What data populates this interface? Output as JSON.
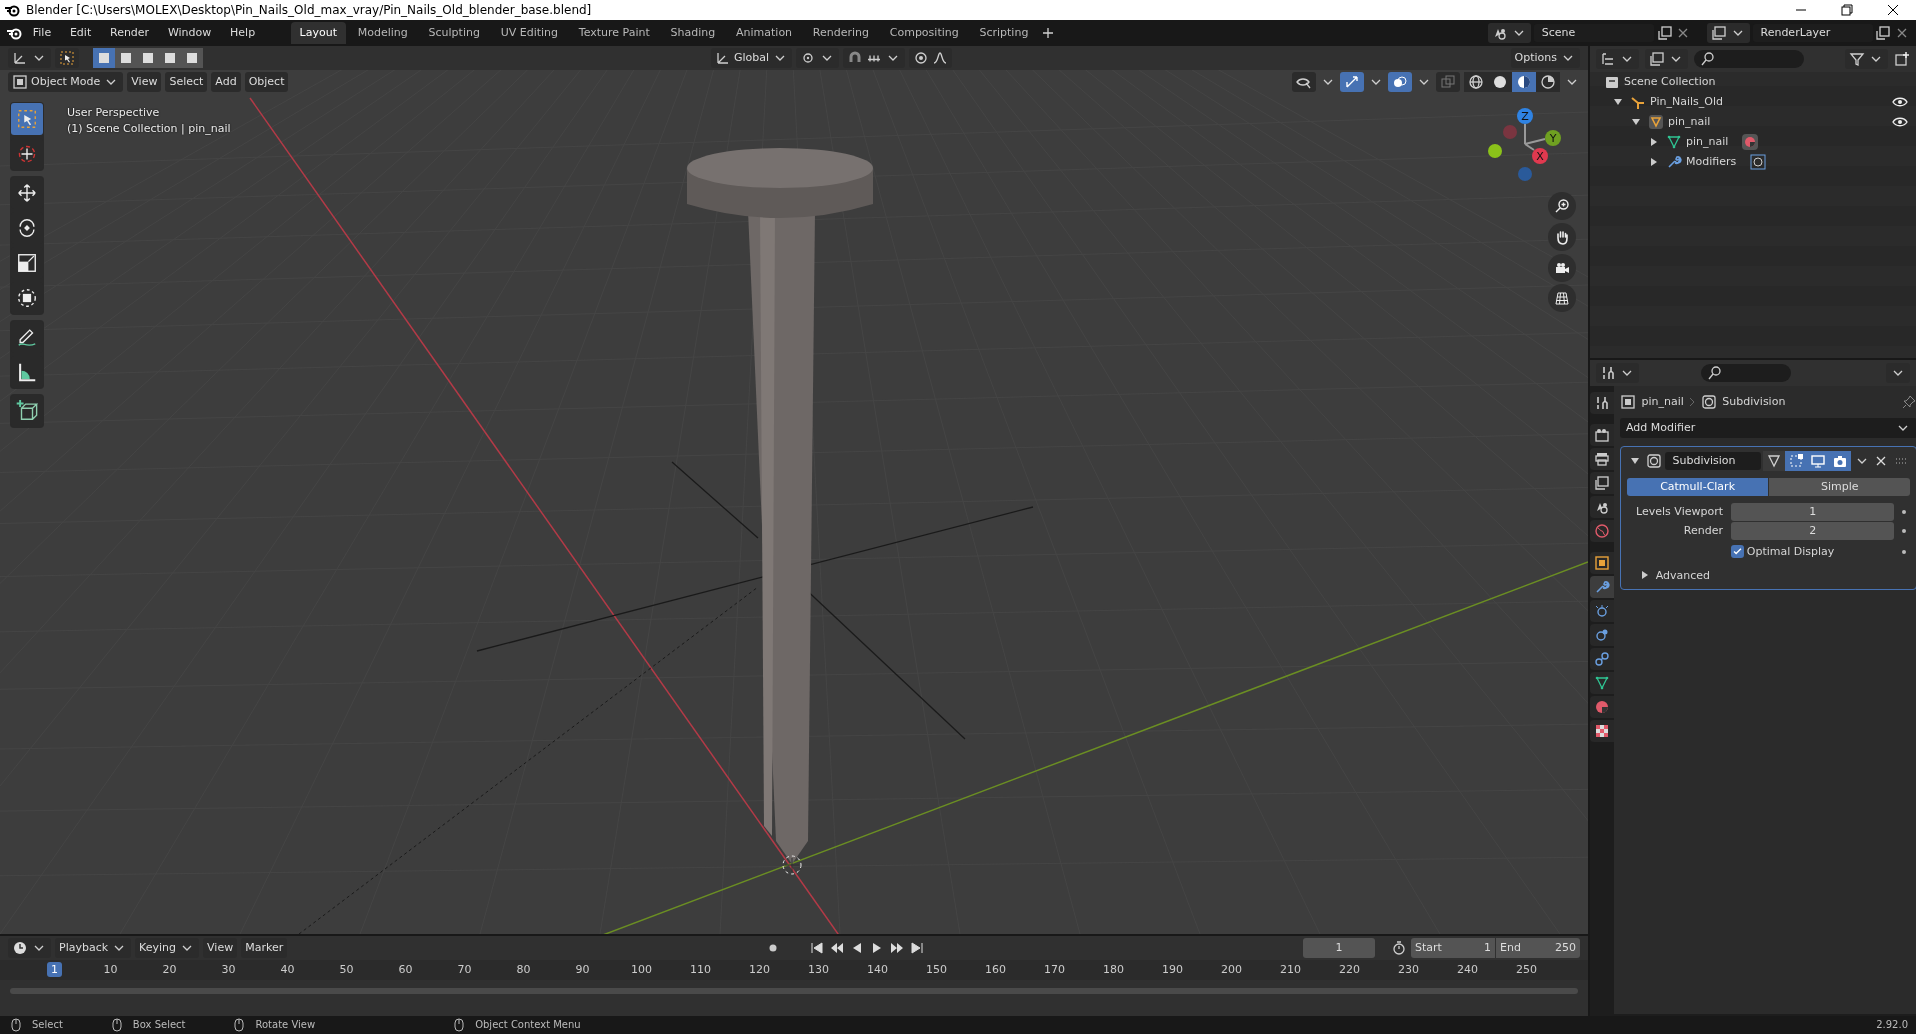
{
  "window": {
    "title": "Blender [C:\\Users\\MOLEX\\Desktop\\Pin_Nails_Old_max_vray/Pin_Nails_Old_blender_base.blend]"
  },
  "menu": [
    "File",
    "Edit",
    "Render",
    "Window",
    "Help"
  ],
  "workspaces": [
    {
      "label": "Layout",
      "selected": true
    },
    {
      "label": "Modeling",
      "selected": false
    },
    {
      "label": "Sculpting",
      "selected": false
    },
    {
      "label": "UV Editing",
      "selected": false
    },
    {
      "label": "Texture Paint",
      "selected": false
    },
    {
      "label": "Shading",
      "selected": false
    },
    {
      "label": "Animation",
      "selected": false
    },
    {
      "label": "Rendering",
      "selected": false
    },
    {
      "label": "Compositing",
      "selected": false
    },
    {
      "label": "Scripting",
      "selected": false
    }
  ],
  "scene": {
    "scene": "Scene",
    "render_layer": "RenderLayer"
  },
  "tool_header": {
    "select_modes": [
      {
        "selected": true
      },
      {
        "selected": false
      },
      {
        "selected": false
      },
      {
        "selected": false
      },
      {
        "selected": false
      }
    ],
    "orientation": "Global",
    "snap_on": false,
    "proportional_on": false,
    "options": "Options"
  },
  "viewport": {
    "mode": "Object Mode",
    "menus": [
      "View",
      "Select",
      "Add",
      "Object"
    ],
    "toggles": [
      {
        "kind": "visibility",
        "on": false
      },
      {
        "kind": "gizmo",
        "on": true
      },
      {
        "kind": "overlay",
        "on": true
      },
      {
        "kind": "xray",
        "on": false
      }
    ],
    "shading": [
      {
        "kind": "wireframe",
        "selected": false
      },
      {
        "kind": "solid",
        "selected": false
      },
      {
        "kind": "material",
        "selected": true
      },
      {
        "kind": "rendered",
        "selected": false
      }
    ],
    "overlay_text": [
      "User Perspective",
      "(1) Scene Collection | pin_nail"
    ],
    "gizmo_axes": [
      "Z",
      "Y",
      "X"
    ],
    "nav_buttons": [
      {
        "kind": "zoom"
      },
      {
        "kind": "pan"
      },
      {
        "kind": "camera"
      },
      {
        "kind": "ortho"
      }
    ]
  },
  "tool_groups": [
    {
      "tools": [
        {
          "kind": "select",
          "selected": true
        },
        {
          "kind": "cursor",
          "selected": false
        }
      ]
    },
    {
      "tools": [
        {
          "kind": "move",
          "selected": false
        },
        {
          "kind": "rotate",
          "selected": false
        },
        {
          "kind": "scale",
          "selected": false
        },
        {
          "kind": "transform",
          "selected": false
        }
      ]
    },
    {
      "tools": [
        {
          "kind": "annotate",
          "selected": false
        },
        {
          "kind": "measure",
          "selected": false
        }
      ]
    },
    {
      "tools": [
        {
          "kind": "add_cube",
          "selected": false
        }
      ]
    }
  ],
  "outliner": {
    "root": "Scene Collection",
    "items": [
      {
        "label": "Pin_Nails_Old",
        "kind": "collection",
        "expanded": true,
        "visible": true,
        "children": [
          {
            "label": "pin_nail",
            "kind": "object",
            "expanded": true,
            "visible": true,
            "children": [
              {
                "label": "pin_nail",
                "kind": "mesh",
                "expanded": false,
                "visible": false
              },
              {
                "label": "Modifiers",
                "kind": "modifiers",
                "expanded": false,
                "visible": false
              }
            ]
          }
        ]
      }
    ]
  },
  "properties": {
    "tabs": [
      {
        "kind": "tool",
        "selected": false
      },
      {
        "kind": "render",
        "selected": false
      },
      {
        "kind": "output",
        "selected": false
      },
      {
        "kind": "view_layer",
        "selected": false
      },
      {
        "kind": "scene",
        "selected": false
      },
      {
        "kind": "world",
        "selected": false
      },
      {
        "kind": "object",
        "selected": false
      },
      {
        "kind": "modifiers",
        "selected": true
      },
      {
        "kind": "particles",
        "selected": false
      },
      {
        "kind": "physics",
        "selected": false
      },
      {
        "kind": "constraints",
        "selected": false
      },
      {
        "kind": "data",
        "selected": false
      },
      {
        "kind": "material",
        "selected": false
      },
      {
        "kind": "texture",
        "selected": false
      }
    ],
    "breadcrumb": [
      "pin_nail",
      "Subdivision"
    ],
    "add_modifier": "Add Modifier",
    "modifier": {
      "name": "Subdivision",
      "expanded": true,
      "toggles": [
        {
          "kind": "cage",
          "on": false
        },
        {
          "kind": "editmode",
          "on": true
        },
        {
          "kind": "viewport",
          "on": true
        },
        {
          "kind": "render",
          "on": true
        }
      ],
      "types": [
        {
          "label": "Catmull-Clark",
          "selected": true
        },
        {
          "label": "Simple",
          "selected": false
        }
      ],
      "fields": [
        {
          "label": "Levels Viewport",
          "value": "1"
        },
        {
          "label": "Render",
          "value": "2"
        }
      ],
      "optimal_display": {
        "label": "Optimal Display",
        "checked": true
      },
      "advanced": {
        "label": "Advanced",
        "expanded": false
      }
    }
  },
  "timeline": {
    "menus": [
      "Playback",
      "Keying",
      "View",
      "Marker"
    ],
    "current_frame": "1",
    "start_label": "Start",
    "start": "1",
    "end_label": "End",
    "end": "250",
    "ruler": [
      {
        "label": "1",
        "selected": true
      },
      {
        "label": "10",
        "selected": false
      },
      {
        "label": "20",
        "selected": false
      },
      {
        "label": "30",
        "selected": false
      },
      {
        "label": "40",
        "selected": false
      },
      {
        "label": "50",
        "selected": false
      },
      {
        "label": "60",
        "selected": false
      },
      {
        "label": "70",
        "selected": false
      },
      {
        "label": "80",
        "selected": false
      },
      {
        "label": "90",
        "selected": false
      },
      {
        "label": "100",
        "selected": false
      },
      {
        "label": "110",
        "selected": false
      },
      {
        "label": "120",
        "selected": false
      },
      {
        "label": "130",
        "selected": false
      },
      {
        "label": "140",
        "selected": false
      },
      {
        "label": "150",
        "selected": false
      },
      {
        "label": "160",
        "selected": false
      },
      {
        "label": "170",
        "selected": false
      },
      {
        "label": "180",
        "selected": false
      },
      {
        "label": "190",
        "selected": false
      },
      {
        "label": "200",
        "selected": false
      },
      {
        "label": "210",
        "selected": false
      },
      {
        "label": "220",
        "selected": false
      },
      {
        "label": "230",
        "selected": false
      },
      {
        "label": "240",
        "selected": false
      },
      {
        "label": "250",
        "selected": false
      }
    ]
  },
  "status_bar": {
    "hints": [
      "Select",
      "Box Select",
      "Rotate View",
      "Object Context Menu"
    ],
    "version": "2.92.0"
  }
}
